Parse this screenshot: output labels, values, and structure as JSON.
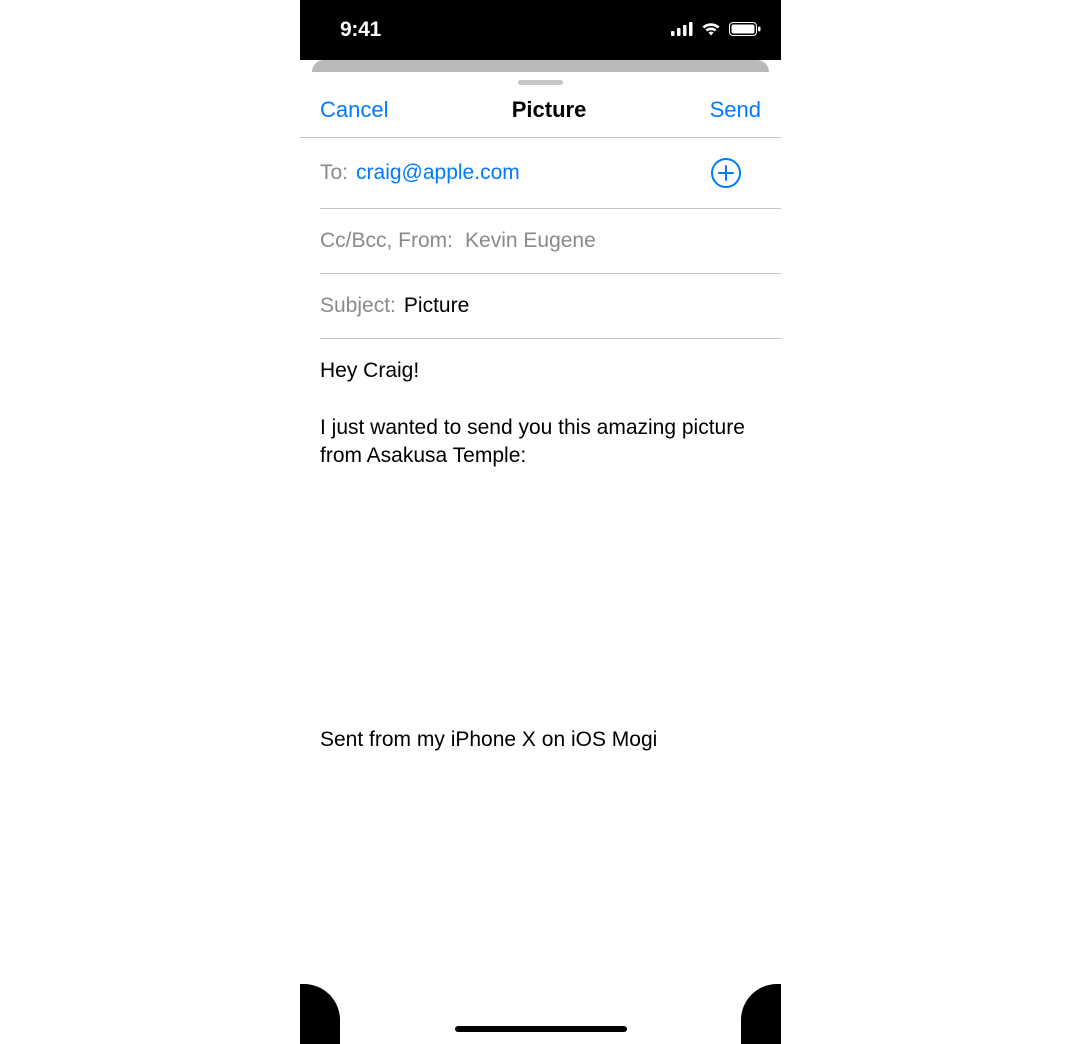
{
  "status": {
    "time": "9:41"
  },
  "nav": {
    "cancel": "Cancel",
    "title": "Picture",
    "send": "Send"
  },
  "to": {
    "label": "To:",
    "value": "craig@apple.com"
  },
  "ccbcc": {
    "label": "Cc/Bcc, From:",
    "value": "Kevin Eugene"
  },
  "subject": {
    "label": "Subject:",
    "value": "Picture"
  },
  "body": {
    "greeting": "Hey Craig!",
    "paragraph": "I just wanted to send you this amazing picture from Asakusa Temple:",
    "signature": "Sent from my iPhone X on iOS Mogi"
  }
}
